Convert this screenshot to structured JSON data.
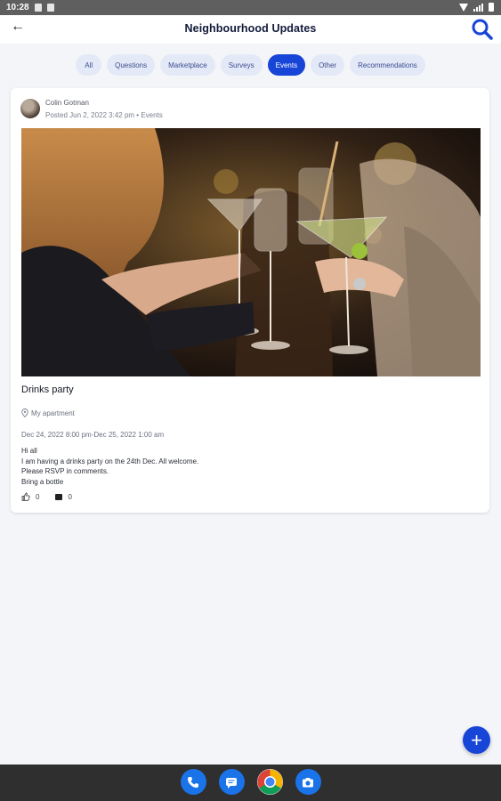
{
  "status": {
    "time": "10:28"
  },
  "header": {
    "title": "Neighbourhood Updates"
  },
  "filters": [
    {
      "label": "All",
      "active": false
    },
    {
      "label": "Questions",
      "active": false
    },
    {
      "label": "Marketplace",
      "active": false
    },
    {
      "label": "Surveys",
      "active": false
    },
    {
      "label": "Events",
      "active": true
    },
    {
      "label": "Other",
      "active": false
    },
    {
      "label": "Recommendations",
      "active": false
    }
  ],
  "post": {
    "author": "Colin Gotman",
    "meta": "Posted Jun 2, 2022 3:42 pm • Events",
    "title": "Drinks party",
    "location": "My apartment",
    "dates": "Dec 24, 2022 8:00 pm-Dec 25, 2022 1:00 am",
    "body_lines": [
      "Hi all",
      "I am having a drinks party on the 24th Dec. All welcome.",
      "Please RSVP in comments.",
      "Bring a bottle"
    ],
    "likes": "0",
    "comments": "0"
  },
  "colors": {
    "accent": "#1745d8",
    "chip_bg": "#e4e9f7"
  },
  "icons": {
    "back": "back-arrow-icon",
    "search": "search-icon",
    "location": "location-pin-icon",
    "like": "thumbs-up-icon",
    "comment": "comment-icon",
    "fab": "plus-icon"
  }
}
